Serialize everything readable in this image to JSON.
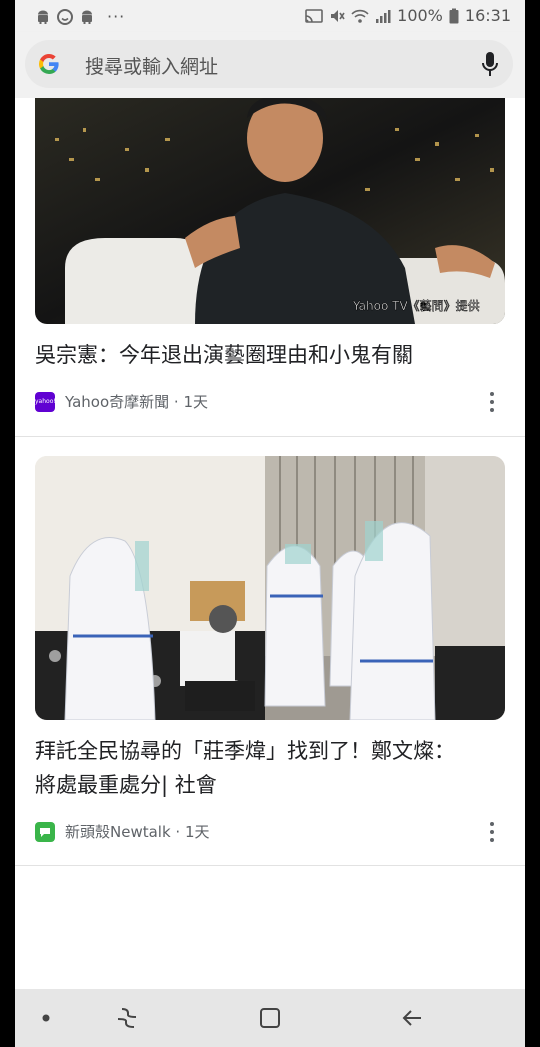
{
  "status_bar": {
    "left_icons": [
      "android-icon",
      "smile-icon",
      "android-icon"
    ],
    "overflow": "···",
    "right_icons": [
      "cast-icon",
      "mute-icon",
      "wifi-icon",
      "signal-icon"
    ],
    "battery": "100%",
    "time": "16:31"
  },
  "search": {
    "placeholder": "搜尋或輸入網址"
  },
  "cards": [
    {
      "image_caption": "Yahoo TV《藝問》提供",
      "headline": "吳宗憲：今年退出演藝圈理由和小鬼有關",
      "source": "Yahoo奇摩新聞 · 1天",
      "source_icon_text": "yahoo!",
      "source_color": "#6001d2"
    },
    {
      "headline_line1": "拜託全民協尋的「莊季煒」找到了！鄭文燦：",
      "headline_line2": "將處最重處分| 社會",
      "source": "新頭殼Newtalk · 1天",
      "source_color": "#3ab54a"
    }
  ],
  "nav": {
    "buttons": [
      "dot-icon",
      "recent-apps-icon",
      "home-icon",
      "back-icon"
    ]
  }
}
